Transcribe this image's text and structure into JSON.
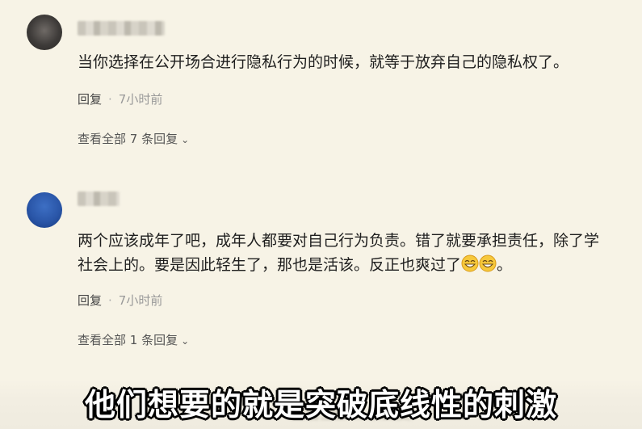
{
  "comments": [
    {
      "text": "当你选择在公开场合进行隐私行为的时候，就等于放弃自己的隐私权了。",
      "reply_label": "回复",
      "time": "7小时前",
      "view_all": "查看全部 7 条回复"
    },
    {
      "text_line1": "两个应该成年了吧，成年人都要对自己行为负责。错了就要承担责任，除了学",
      "text_line2": "社会上的。要是因此轻生了，那也是活该。反正也爽过了",
      "text_end": "。",
      "reply_label": "回复",
      "time": "7小时前",
      "view_all": "查看全部 1 条回复"
    }
  ],
  "ghost_text": "查看全部 1 条回复",
  "subtitle": "他们想要的就是突破底线性的刺激",
  "icons": {
    "chevron": "chevron-down-icon",
    "emoji": "grinning-face-icon"
  },
  "colors": {
    "background": "#f7f3e6",
    "subtitle_fill": "#ffffff",
    "subtitle_outline": "#000000"
  }
}
